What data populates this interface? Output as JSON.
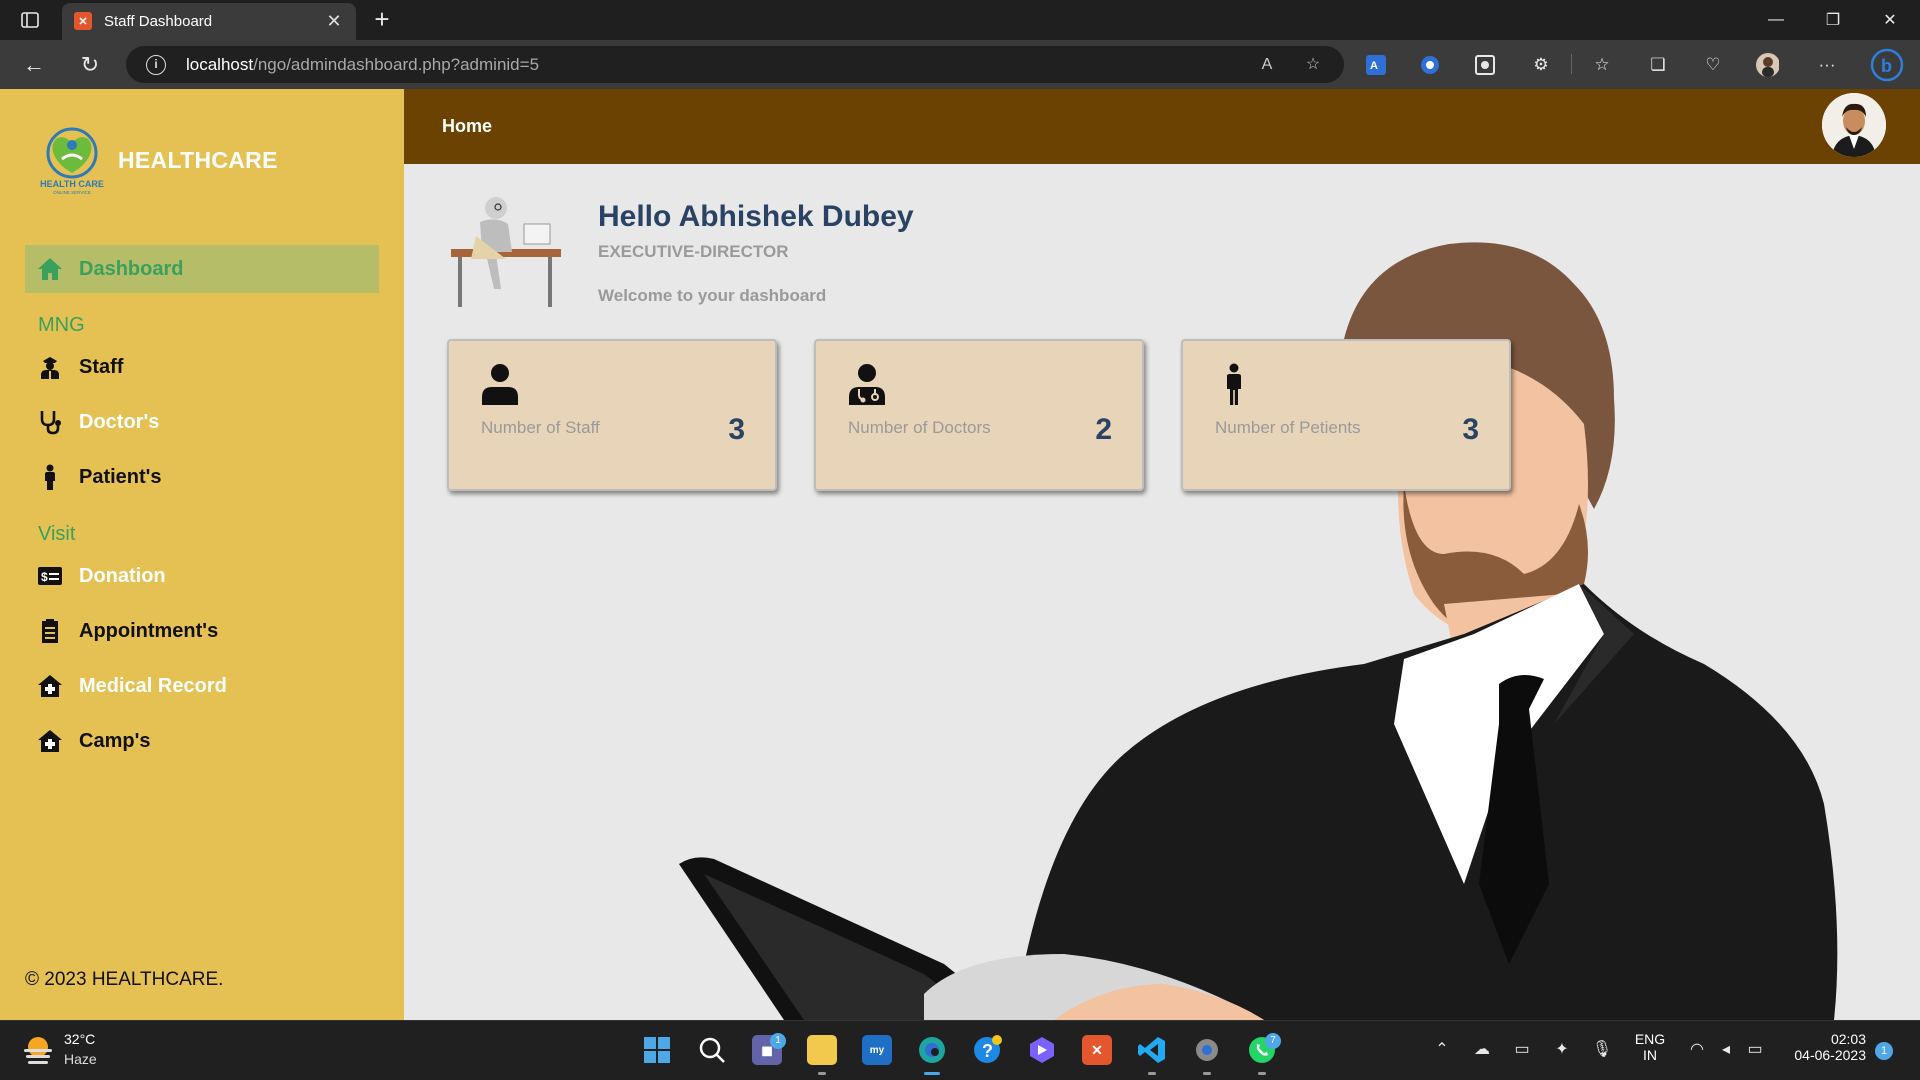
{
  "browser": {
    "tab_title": "Staff Dashboard",
    "url_host": "localhost",
    "url_path": "/ngo/admindashboard.php?adminid=5"
  },
  "sidebar": {
    "brand": "HEALTHCARE",
    "logo_text": "HEALTH CARE",
    "logo_subtext": "ONLINE SERVICE",
    "items": [
      {
        "label": "Dashboard",
        "icon": "home-icon"
      },
      {
        "section": "MNG"
      },
      {
        "label": "Staff",
        "icon": "staff-icon"
      },
      {
        "label": "Doctor's",
        "icon": "stethoscope-icon"
      },
      {
        "label": "Patient's",
        "icon": "person-icon"
      },
      {
        "section": "Visit"
      },
      {
        "label": "Donation",
        "icon": "donation-icon"
      },
      {
        "label": "Appointment's",
        "icon": "clipboard-icon"
      },
      {
        "label": "Medical Record",
        "icon": "medical-house-icon"
      },
      {
        "label": "Camp's",
        "icon": "medical-house-icon"
      }
    ],
    "footer": "© 2023 HEALTHCARE."
  },
  "topbar": {
    "title": "Home"
  },
  "main": {
    "greeting": "Hello Abhishek Dubey",
    "role": "EXECUTIVE-DIRECTOR",
    "welcome": "Welcome to your dashboard",
    "cards": [
      {
        "label": "Number of Staff",
        "value": "3",
        "icon": "user-icon"
      },
      {
        "label": "Number of Doctors",
        "value": "2",
        "icon": "doctor-icon"
      },
      {
        "label": "Number of Petients",
        "value": "3",
        "icon": "person-standing-icon"
      }
    ]
  },
  "taskbar": {
    "weather_temp": "32°C",
    "weather_cond": "Haze",
    "lang_top": "ENG",
    "lang_bottom": "IN",
    "time": "02:03",
    "date": "04-06-2023",
    "notification_count": "1",
    "badges": {
      "teams": "1",
      "whatsapp": "7"
    }
  },
  "colors": {
    "sidebar": "#e5c153",
    "active_item": "#b5bd68",
    "accent_green": "#3aa05c",
    "topbar": "#6b4201",
    "heading": "#2a4263",
    "card": "#e8d4b8"
  }
}
